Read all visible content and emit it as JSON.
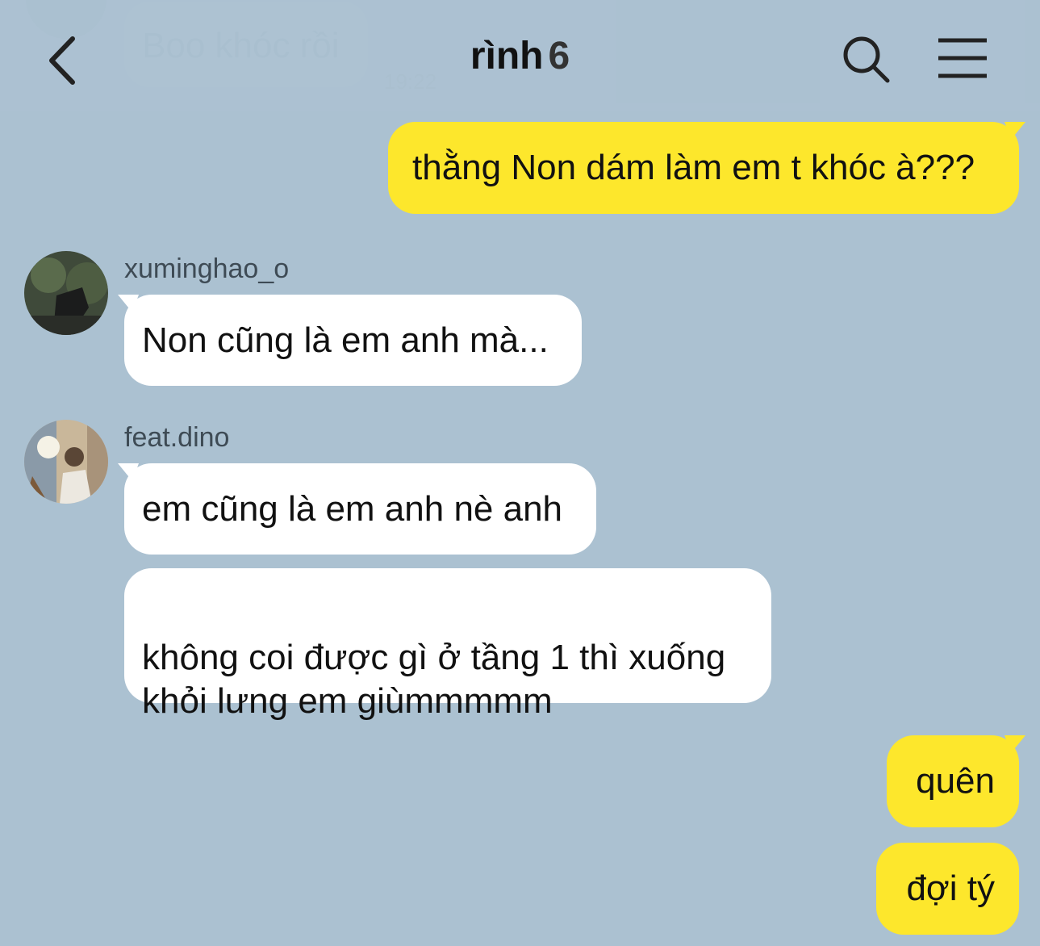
{
  "header": {
    "title": "rình",
    "member_count": "6",
    "icons": {
      "back": "chevron-left-icon",
      "search": "search-icon",
      "menu": "hamburger-menu-icon"
    }
  },
  "ghost_message": {
    "text": "Boo khóc rồi",
    "time": "19:22"
  },
  "messages": [
    {
      "from": "me",
      "text": "thằng Non dám làm em t khóc à???"
    },
    {
      "from": "xuminghao_o",
      "sender": "xuminghao_o",
      "text": "Non cũng là em anh mà..."
    },
    {
      "from": "feat.dino",
      "sender": "feat.dino",
      "text": "em cũng là em anh nè anh"
    },
    {
      "from": "feat.dino",
      "text": "không coi được gì ở tầng 1 thì xuống\nkhỏi lưng em giùmmmmm"
    },
    {
      "from": "me",
      "text": "quên"
    },
    {
      "from": "me",
      "text": "đợi tý"
    }
  ],
  "colors": {
    "background": "#abc1d1",
    "my_bubble": "#fde72c",
    "their_bubble": "#ffffff"
  }
}
